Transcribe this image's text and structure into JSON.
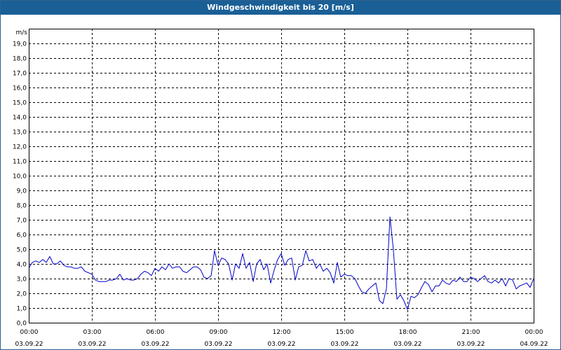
{
  "window": {
    "title": "Windgeschwindigkeit bis 20 [m/s]"
  },
  "colors": {
    "titlebar": "#1a5f96",
    "line": "#0000c8",
    "grid": "#000000"
  },
  "chart_data": {
    "type": "line",
    "title": "Windgeschwindigkeit bis 20 [m/s]",
    "ylabel": "m/s",
    "ylim": [
      0,
      20
    ],
    "y_ticks": [
      "0,0",
      "1,0",
      "2,0",
      "3,0",
      "4,0",
      "5,0",
      "6,0",
      "7,0",
      "8,0",
      "9,0",
      "10,0",
      "11,0",
      "12,0",
      "13,0",
      "14,0",
      "15,0",
      "16,0",
      "17,0",
      "18,0",
      "19,0"
    ],
    "x_ticks": [
      {
        "time": "00:00",
        "date": "03.09.22"
      },
      {
        "time": "03:00",
        "date": "03.09.22"
      },
      {
        "time": "06:00",
        "date": "03.09.22"
      },
      {
        "time": "09:00",
        "date": "03.09.22"
      },
      {
        "time": "12:00",
        "date": "03.09.22"
      },
      {
        "time": "15:00",
        "date": "03.09.22"
      },
      {
        "time": "18:00",
        "date": "03.09.22"
      },
      {
        "time": "21:00",
        "date": "03.09.22"
      },
      {
        "time": "00:00",
        "date": "04.09.22"
      }
    ],
    "xlim_hours": [
      0,
      24
    ],
    "grid": true,
    "series": [
      {
        "points": [
          [
            0.0,
            3.7
          ],
          [
            0.17,
            4.1
          ],
          [
            0.33,
            4.2
          ],
          [
            0.5,
            4.1
          ],
          [
            0.67,
            4.3
          ],
          [
            0.83,
            4.1
          ],
          [
            1.0,
            4.5
          ],
          [
            1.17,
            4.0
          ],
          [
            1.33,
            4.0
          ],
          [
            1.5,
            4.2
          ],
          [
            1.67,
            3.9
          ],
          [
            1.83,
            3.8
          ],
          [
            2.0,
            3.8
          ],
          [
            2.17,
            3.7
          ],
          [
            2.33,
            3.7
          ],
          [
            2.5,
            3.8
          ],
          [
            2.67,
            3.5
          ],
          [
            2.83,
            3.4
          ],
          [
            3.0,
            3.3
          ],
          [
            3.17,
            2.9
          ],
          [
            3.33,
            2.8
          ],
          [
            3.5,
            2.8
          ],
          [
            3.67,
            2.8
          ],
          [
            3.83,
            2.9
          ],
          [
            4.0,
            2.9
          ],
          [
            4.17,
            3.0
          ],
          [
            4.33,
            3.3
          ],
          [
            4.5,
            2.9
          ],
          [
            4.67,
            3.0
          ],
          [
            4.83,
            2.9
          ],
          [
            5.0,
            2.9
          ],
          [
            5.17,
            3.0
          ],
          [
            5.33,
            3.3
          ],
          [
            5.5,
            3.5
          ],
          [
            5.67,
            3.4
          ],
          [
            5.83,
            3.2
          ],
          [
            6.0,
            3.7
          ],
          [
            6.17,
            3.5
          ],
          [
            6.33,
            3.8
          ],
          [
            6.5,
            3.6
          ],
          [
            6.67,
            4.0
          ],
          [
            6.83,
            3.7
          ],
          [
            7.0,
            3.8
          ],
          [
            7.17,
            3.8
          ],
          [
            7.33,
            3.5
          ],
          [
            7.5,
            3.4
          ],
          [
            7.67,
            3.6
          ],
          [
            7.83,
            3.8
          ],
          [
            8.0,
            3.8
          ],
          [
            8.17,
            3.6
          ],
          [
            8.33,
            3.1
          ],
          [
            8.5,
            3.0
          ],
          [
            8.67,
            3.2
          ],
          [
            8.83,
            4.9
          ],
          [
            9.0,
            3.9
          ],
          [
            9.17,
            4.4
          ],
          [
            9.33,
            4.3
          ],
          [
            9.5,
            4.0
          ],
          [
            9.67,
            2.9
          ],
          [
            9.83,
            4.0
          ],
          [
            10.0,
            3.7
          ],
          [
            10.17,
            4.7
          ],
          [
            10.33,
            3.7
          ],
          [
            10.5,
            4.1
          ],
          [
            10.67,
            2.8
          ],
          [
            10.83,
            4.0
          ],
          [
            11.0,
            4.3
          ],
          [
            11.17,
            3.6
          ],
          [
            11.33,
            4.0
          ],
          [
            11.5,
            2.7
          ],
          [
            11.67,
            3.6
          ],
          [
            11.83,
            4.3
          ],
          [
            12.0,
            4.7
          ],
          [
            12.17,
            3.9
          ],
          [
            12.33,
            4.3
          ],
          [
            12.5,
            4.4
          ],
          [
            12.67,
            2.9
          ],
          [
            12.83,
            3.8
          ],
          [
            13.0,
            3.9
          ],
          [
            13.17,
            4.9
          ],
          [
            13.33,
            4.2
          ],
          [
            13.5,
            4.3
          ],
          [
            13.67,
            3.7
          ],
          [
            13.83,
            4.0
          ],
          [
            14.0,
            3.5
          ],
          [
            14.17,
            3.7
          ],
          [
            14.33,
            3.4
          ],
          [
            14.5,
            2.7
          ],
          [
            14.67,
            4.1
          ],
          [
            14.83,
            3.1
          ],
          [
            15.0,
            3.3
          ],
          [
            15.17,
            3.2
          ],
          [
            15.33,
            3.2
          ],
          [
            15.5,
            3.0
          ],
          [
            15.67,
            2.5
          ],
          [
            15.83,
            2.1
          ],
          [
            16.0,
            2.0
          ],
          [
            16.17,
            2.3
          ],
          [
            16.33,
            2.5
          ],
          [
            16.5,
            2.7
          ],
          [
            16.67,
            1.5
          ],
          [
            16.83,
            1.3
          ],
          [
            17.0,
            2.3
          ],
          [
            17.17,
            7.2
          ],
          [
            17.33,
            5.0
          ],
          [
            17.5,
            1.6
          ],
          [
            17.67,
            1.9
          ],
          [
            17.83,
            1.5
          ],
          [
            18.0,
            0.9
          ],
          [
            18.17,
            1.8
          ],
          [
            18.33,
            1.7
          ],
          [
            18.5,
            1.9
          ],
          [
            18.67,
            2.4
          ],
          [
            18.83,
            2.8
          ],
          [
            19.0,
            2.6
          ],
          [
            19.17,
            2.1
          ],
          [
            19.33,
            2.5
          ],
          [
            19.5,
            2.5
          ],
          [
            19.67,
            2.9
          ],
          [
            19.83,
            2.7
          ],
          [
            20.0,
            2.6
          ],
          [
            20.17,
            2.9
          ],
          [
            20.33,
            2.8
          ],
          [
            20.5,
            3.1
          ],
          [
            20.67,
            2.8
          ],
          [
            20.83,
            2.8
          ],
          [
            21.0,
            3.1
          ],
          [
            21.17,
            3.0
          ],
          [
            21.33,
            2.8
          ],
          [
            21.5,
            3.0
          ],
          [
            21.67,
            3.2
          ],
          [
            21.83,
            2.8
          ],
          [
            22.0,
            2.7
          ],
          [
            22.17,
            2.9
          ],
          [
            22.33,
            2.7
          ],
          [
            22.5,
            3.0
          ],
          [
            22.67,
            2.5
          ],
          [
            22.83,
            3.0
          ],
          [
            23.0,
            2.9
          ],
          [
            23.17,
            2.3
          ],
          [
            23.33,
            2.5
          ],
          [
            23.5,
            2.6
          ],
          [
            23.67,
            2.7
          ],
          [
            23.83,
            2.4
          ],
          [
            24.0,
            3.0
          ]
        ]
      }
    ]
  }
}
